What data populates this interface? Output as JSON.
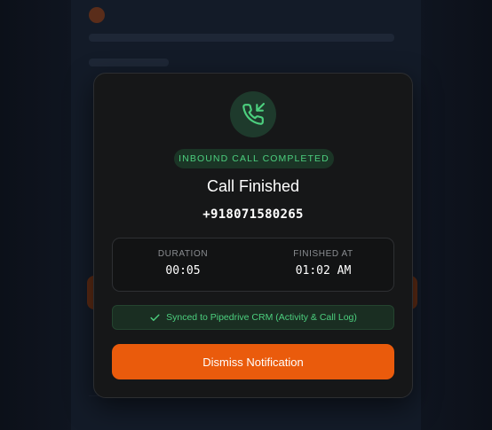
{
  "modal": {
    "badge": "INBOUND CALL COMPLETED",
    "title": "Call Finished",
    "phone_number": "+918071580265",
    "stats": {
      "duration_label": "DURATION",
      "duration_value": "00:05",
      "finished_label": "FINISHED AT",
      "finished_value": "01:02 AM"
    },
    "sync_message": "Synced to Pipedrive CRM (Activity & Call Log)",
    "dismiss_label": "Dismiss Notification",
    "icons": {
      "call": "phone-incoming-icon",
      "sync": "check-icon"
    }
  },
  "colors": {
    "accent_green": "#4ccf7e",
    "button_orange": "#ea5b0c",
    "modal_bg": "#161718"
  }
}
